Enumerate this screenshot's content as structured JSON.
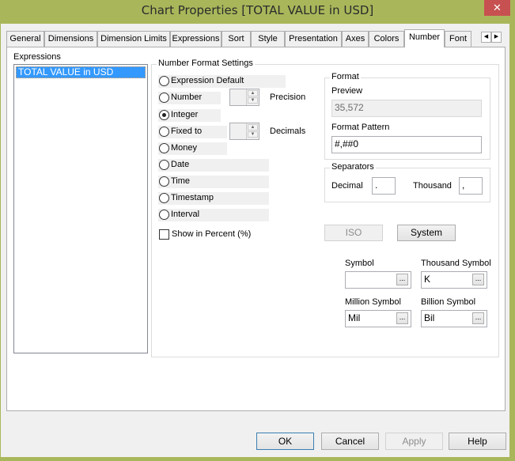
{
  "window": {
    "title": "Chart Properties [TOTAL VALUE in USD]",
    "close_glyph": "✕"
  },
  "tabs": [
    {
      "label": "General"
    },
    {
      "label": "Dimensions"
    },
    {
      "label": "Dimension Limits"
    },
    {
      "label": "Expressions"
    },
    {
      "label": "Sort"
    },
    {
      "label": "Style"
    },
    {
      "label": "Presentation"
    },
    {
      "label": "Axes"
    },
    {
      "label": "Colors"
    },
    {
      "label": "Number",
      "active": true
    },
    {
      "label": "Font"
    }
  ],
  "tab_scroll": {
    "left": "◀",
    "right": "▶"
  },
  "expressions": {
    "label": "Expressions",
    "items": [
      "TOTAL VALUE in USD"
    ],
    "selected": "TOTAL VALUE in USD"
  },
  "number_format": {
    "group_title": "Number Format Settings",
    "options": [
      {
        "label": "Expression Default",
        "checked": false
      },
      {
        "label": "Number",
        "checked": false
      },
      {
        "label": "Integer",
        "checked": true
      },
      {
        "label": "Fixed to",
        "checked": false
      },
      {
        "label": "Money",
        "checked": false
      },
      {
        "label": "Date",
        "checked": false
      },
      {
        "label": "Time",
        "checked": false
      },
      {
        "label": "Timestamp",
        "checked": false
      },
      {
        "label": "Interval",
        "checked": false
      }
    ],
    "precision_label": "Precision",
    "precision_value": "",
    "decimals_label": "Decimals",
    "decimals_value": "",
    "show_percent_label": "Show in Percent (%)",
    "show_percent_checked": false
  },
  "format": {
    "group_title": "Format",
    "preview_label": "Preview",
    "preview_value": "35,572",
    "pattern_label": "Format Pattern",
    "pattern_value": "#,##0"
  },
  "separators": {
    "group_title": "Separators",
    "decimal_label": "Decimal",
    "decimal_value": ".",
    "thousand_label": "Thousand",
    "thousand_value": ","
  },
  "iso_button": "ISO",
  "system_button": "System",
  "symbols": {
    "symbol_label": "Symbol",
    "symbol_value": "",
    "thousand_label": "Thousand Symbol",
    "thousand_value": "K",
    "million_label": "Million Symbol",
    "million_value": "Mil",
    "billion_label": "Billion Symbol",
    "billion_value": "Bil",
    "ellipsis": "..."
  },
  "footer": {
    "ok": "OK",
    "cancel": "Cancel",
    "apply": "Apply",
    "help": "Help"
  }
}
